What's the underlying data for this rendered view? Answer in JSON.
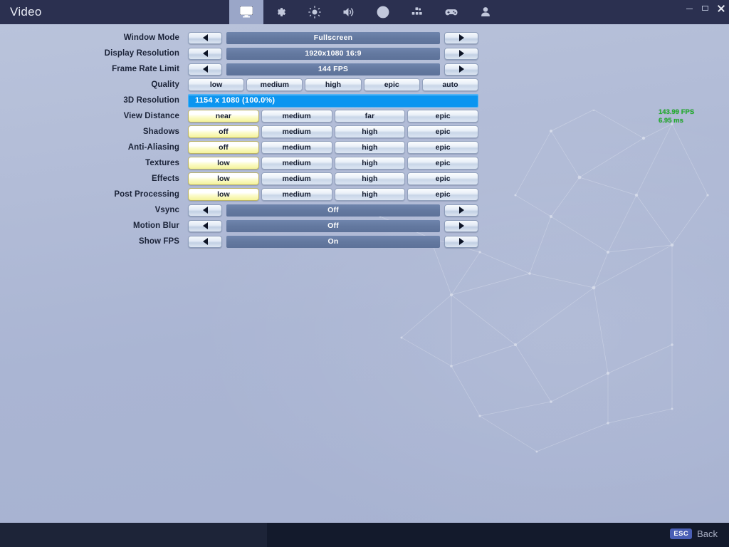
{
  "window": {
    "title": "Video",
    "controls": [
      {
        "name": "minimize-button",
        "label": "—"
      },
      {
        "name": "maximize-button",
        "label": "▢"
      },
      {
        "name": "close-button",
        "label": "✕"
      }
    ]
  },
  "tabs": [
    {
      "icon": "monitor-icon",
      "label": "Video",
      "active": true
    },
    {
      "icon": "gear-icon",
      "label": "Game",
      "active": false
    },
    {
      "icon": "brightness-icon",
      "label": "Brightness",
      "active": false
    },
    {
      "icon": "speaker-icon",
      "label": "Audio",
      "active": false
    },
    {
      "icon": "accessibility-icon",
      "label": "Accessibility",
      "active": false
    },
    {
      "icon": "modes-grid-icon",
      "label": "Game Modes",
      "active": false
    },
    {
      "icon": "controller-icon",
      "label": "Input",
      "active": false
    },
    {
      "icon": "account-icon",
      "label": "Account",
      "active": false
    }
  ],
  "settings": [
    {
      "name": "window-mode",
      "label": "Window Mode",
      "type": "stepper",
      "value": "Fullscreen"
    },
    {
      "name": "display-resolution",
      "label": "Display Resolution",
      "type": "stepper",
      "value": "1920x1080  16:9"
    },
    {
      "name": "frame-rate-limit",
      "label": "Frame Rate Limit",
      "type": "stepper",
      "value": "144 FPS"
    },
    {
      "name": "quality",
      "label": "Quality",
      "type": "segmented",
      "options": [
        "low",
        "medium",
        "high",
        "epic",
        "auto"
      ],
      "selected": -1
    },
    {
      "name": "3d-resolution",
      "label": "3D Resolution",
      "type": "slider",
      "value": "1154 x 1080 (100.0%)",
      "percent": 100
    },
    {
      "name": "view-distance",
      "label": "View Distance",
      "type": "segmented",
      "options": [
        "near",
        "medium",
        "far",
        "epic"
      ],
      "selected": 0
    },
    {
      "name": "shadows",
      "label": "Shadows",
      "type": "segmented",
      "options": [
        "off",
        "medium",
        "high",
        "epic"
      ],
      "selected": 0
    },
    {
      "name": "anti-aliasing",
      "label": "Anti-Aliasing",
      "type": "segmented",
      "options": [
        "off",
        "medium",
        "high",
        "epic"
      ],
      "selected": 0
    },
    {
      "name": "textures",
      "label": "Textures",
      "type": "segmented",
      "options": [
        "low",
        "medium",
        "high",
        "epic"
      ],
      "selected": 0
    },
    {
      "name": "effects",
      "label": "Effects",
      "type": "segmented",
      "options": [
        "low",
        "medium",
        "high",
        "epic"
      ],
      "selected": 0
    },
    {
      "name": "post-processing",
      "label": "Post Processing",
      "type": "segmented",
      "options": [
        "low",
        "medium",
        "high",
        "epic"
      ],
      "selected": 0
    },
    {
      "name": "vsync",
      "label": "Vsync",
      "type": "stepper",
      "value": "Off"
    },
    {
      "name": "motion-blur",
      "label": "Motion Blur",
      "type": "stepper",
      "value": "Off"
    },
    {
      "name": "show-fps",
      "label": "Show FPS",
      "type": "stepper",
      "value": "On"
    }
  ],
  "fps_overlay": {
    "fps": "143.99 FPS",
    "frametime": "6.95 ms",
    "color": "#1fb32a"
  },
  "bottom_bar": {
    "back_key": "ESC",
    "back_label": "Back"
  },
  "colors": {
    "titlebar": "#2b3050",
    "tab_active_bg": "#9aa6c8",
    "slider_blue": "#0b95f0",
    "value_bar": "#63789f",
    "selected_yellow": "#f5f39a",
    "bottom_bar": "#131a2c",
    "esc_badge": "#4a5fb5"
  }
}
